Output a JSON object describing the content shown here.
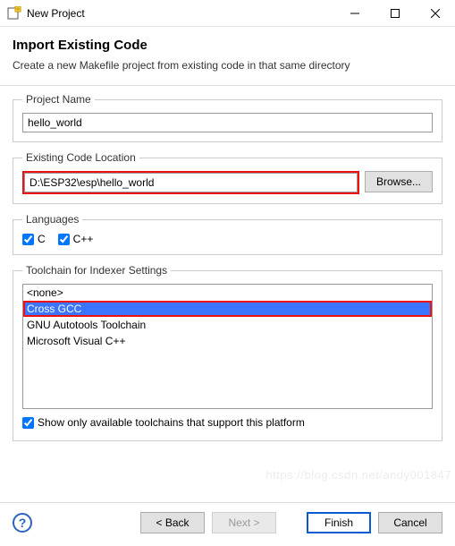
{
  "window": {
    "title": "New Project"
  },
  "header": {
    "title": "Import Existing Code",
    "description": "Create a new Makefile project from existing code in that same directory"
  },
  "projectName": {
    "legend": "Project Name",
    "value": "hello_world"
  },
  "codeLocation": {
    "legend": "Existing Code Location",
    "value": "D:\\ESP32\\esp\\hello_world",
    "browse": "Browse..."
  },
  "languages": {
    "legend": "Languages",
    "items": [
      {
        "label": "C",
        "checked": true
      },
      {
        "label": "C++",
        "checked": true
      }
    ]
  },
  "toolchain": {
    "legend": "Toolchain for Indexer Settings",
    "items": [
      {
        "label": "<none>",
        "selected": false
      },
      {
        "label": "Cross GCC",
        "selected": true
      },
      {
        "label": "GNU Autotools Toolchain",
        "selected": false
      },
      {
        "label": "Microsoft Visual C++",
        "selected": false
      }
    ],
    "showOnly": {
      "label": "Show only available toolchains that support this platform",
      "checked": true
    }
  },
  "footer": {
    "back": "< Back",
    "next": "Next >",
    "finish": "Finish",
    "cancel": "Cancel"
  },
  "watermark": "https://blog.csdn.net/andy001847"
}
